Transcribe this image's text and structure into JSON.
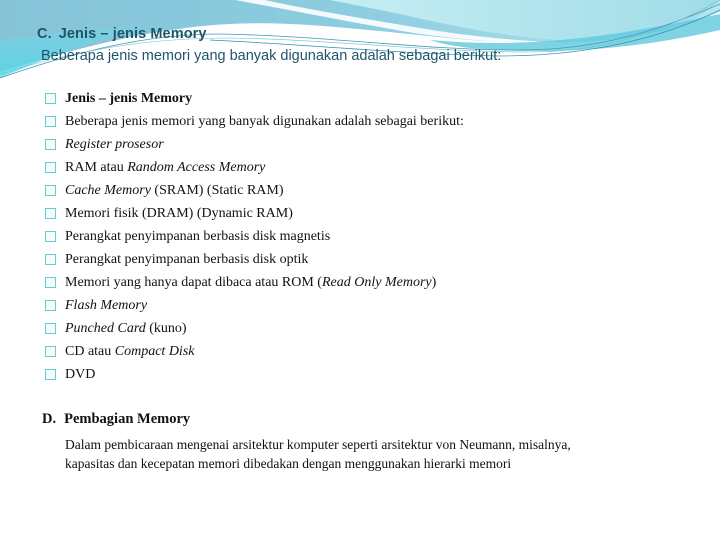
{
  "slide": {
    "section_c": {
      "number": "C.",
      "title": "Jenis – jenis Memory",
      "subtitle": "Beberapa jenis memori yang banyak digunakan adalah sebagai berikut:"
    },
    "bullets": [
      {
        "segments": [
          {
            "text": "Jenis – jenis Memory",
            "italic": false
          }
        ],
        "bold": true
      },
      {
        "segments": [
          {
            "text": "Beberapa jenis memori yang banyak digunakan adalah sebagai berikut:",
            "italic": false
          }
        ],
        "bold": false
      },
      {
        "segments": [
          {
            "text": "Register prosesor",
            "italic": true
          }
        ],
        "bold": false
      },
      {
        "segments": [
          {
            "text": "RAM atau ",
            "italic": false
          },
          {
            "text": "Random Access Memory",
            "italic": true
          }
        ],
        "bold": false
      },
      {
        "segments": [
          {
            "text": "Cache Memory",
            "italic": true
          },
          {
            "text": " (SRAM) (Static RAM)",
            "italic": false
          }
        ],
        "bold": false
      },
      {
        "segments": [
          {
            "text": "Memori fisik (DRAM) (Dynamic RAM)",
            "italic": false
          }
        ],
        "bold": false
      },
      {
        "segments": [
          {
            "text": "Perangkat penyimpanan berbasis disk magnetis",
            "italic": false
          }
        ],
        "bold": false
      },
      {
        "segments": [
          {
            "text": "Perangkat penyimpanan berbasis disk optik",
            "italic": false
          }
        ],
        "bold": false
      },
      {
        "segments": [
          {
            "text": "Memori yang hanya dapat dibaca atau ROM (",
            "italic": false
          },
          {
            "text": "Read Only Memory",
            "italic": true
          },
          {
            "text": ")",
            "italic": false
          }
        ],
        "bold": false
      },
      {
        "segments": [
          {
            "text": "Flash Memory",
            "italic": true
          }
        ],
        "bold": false
      },
      {
        "segments": [
          {
            "text": "Punched Card",
            "italic": true
          },
          {
            "text": " (kuno)",
            "italic": false
          }
        ],
        "bold": false
      },
      {
        "segments": [
          {
            "text": "CD atau ",
            "italic": false
          },
          {
            "text": "Compact Disk",
            "italic": true
          }
        ],
        "bold": false
      },
      {
        "segments": [
          {
            "text": "DVD",
            "italic": false
          }
        ],
        "bold": false
      }
    ],
    "bullet_icon": "checkbox-square-icon",
    "section_d": {
      "number": "D.",
      "title": "Pembagian Memory",
      "body_lines": [
        "Dalam pembicaraan mengenai arsitektur komputer seperti arsitektur von Neumann,  misalnya,",
        "kapasitas dan kecepatan memori dibedakan dengan menggunakan hierarki memori"
      ]
    }
  },
  "theme": {
    "title_color": "#1f5568",
    "wave_dark": "#7fbfd6",
    "wave_light": "#a8e0ea",
    "wave_accent": "#5ccfe0",
    "bullet_border": "#6ccbcc",
    "text_color": "#111111"
  }
}
